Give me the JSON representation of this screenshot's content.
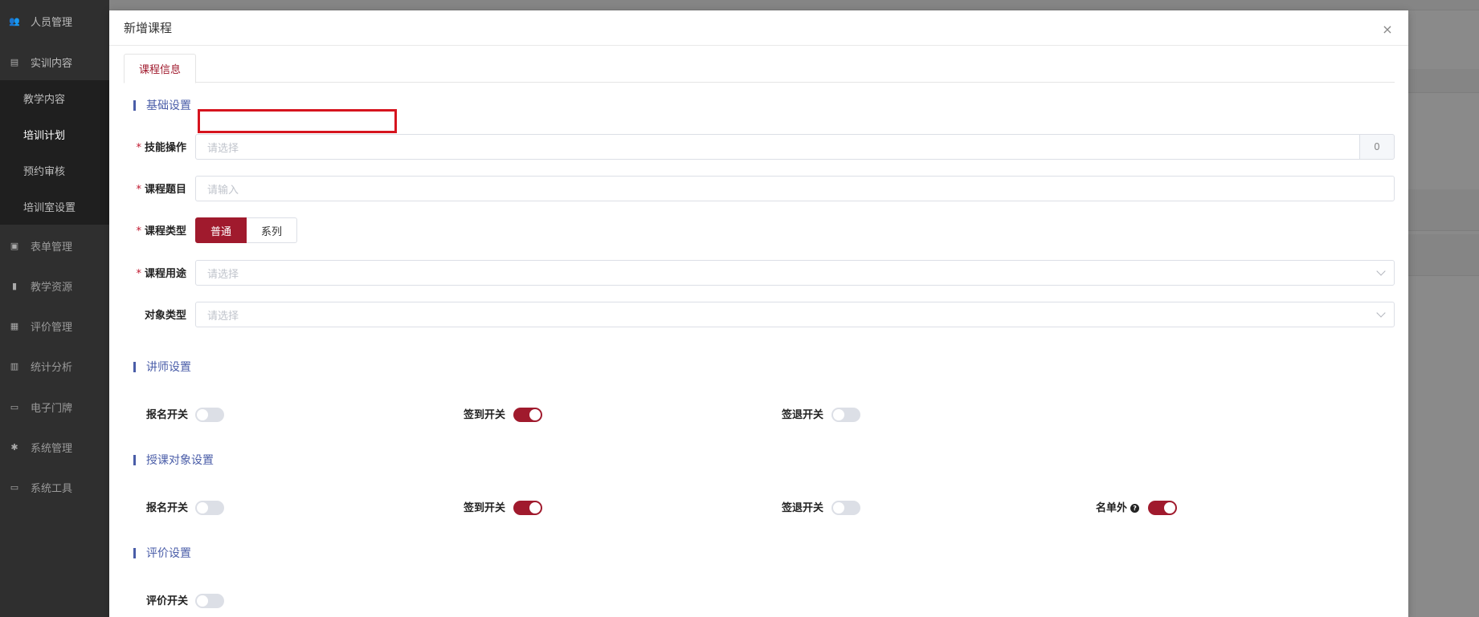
{
  "sidebar": {
    "items": [
      {
        "label": "人员管理",
        "icon": "users-icon",
        "glyph": "👥"
      },
      {
        "label": "实训内容",
        "icon": "book-icon",
        "glyph": "▤"
      },
      {
        "label": "表单管理",
        "icon": "form-icon",
        "glyph": "▣"
      },
      {
        "label": "教学资源",
        "icon": "resource-icon",
        "glyph": "▮"
      },
      {
        "label": "评价管理",
        "icon": "evaluation-icon",
        "glyph": "▦"
      },
      {
        "label": "统计分析",
        "icon": "chart-icon",
        "glyph": "▥"
      },
      {
        "label": "电子门牌",
        "icon": "monitor-icon",
        "glyph": "▭"
      },
      {
        "label": "系统管理",
        "icon": "gear-icon",
        "glyph": "✱"
      },
      {
        "label": "系统工具",
        "icon": "toolbox-icon",
        "glyph": "▭"
      }
    ],
    "sub_items": [
      {
        "label": "教学内容"
      },
      {
        "label": "培训计划"
      },
      {
        "label": "预约审核"
      },
      {
        "label": "培训室设置"
      }
    ]
  },
  "modal": {
    "title": "新增课程",
    "close_glyph": "×",
    "tab_label": "课程信息",
    "sections": {
      "basic": "基础设置",
      "lecturer": "讲师设置",
      "target": "授课对象设置",
      "evaluation": "评价设置"
    },
    "fields": {
      "skill": {
        "label": "技能操作",
        "placeholder": "请选择",
        "count": "0"
      },
      "topic": {
        "label": "课程题目",
        "placeholder": "请输入"
      },
      "type": {
        "label": "课程类型",
        "options": [
          "普通",
          "系列"
        ],
        "selected": "普通"
      },
      "usage": {
        "label": "课程用途",
        "placeholder": "请选择"
      },
      "object_type": {
        "label": "对象类型",
        "placeholder": "请选择"
      }
    },
    "required_mark": "*",
    "lecturer_switches": [
      {
        "label": "报名开关",
        "on": false
      },
      {
        "label": "签到开关",
        "on": true
      },
      {
        "label": "签退开关",
        "on": false
      }
    ],
    "target_switches": [
      {
        "label": "报名开关",
        "on": false
      },
      {
        "label": "签到开关",
        "on": true
      },
      {
        "label": "签退开关",
        "on": false
      },
      {
        "label": "名单外",
        "on": true,
        "help": "?"
      }
    ],
    "evaluation_switches": [
      {
        "label": "评价开关",
        "on": false
      }
    ]
  },
  "colors": {
    "primary": "#a01a2d",
    "section": "#4a5da8",
    "highlight": "#d6141e"
  }
}
